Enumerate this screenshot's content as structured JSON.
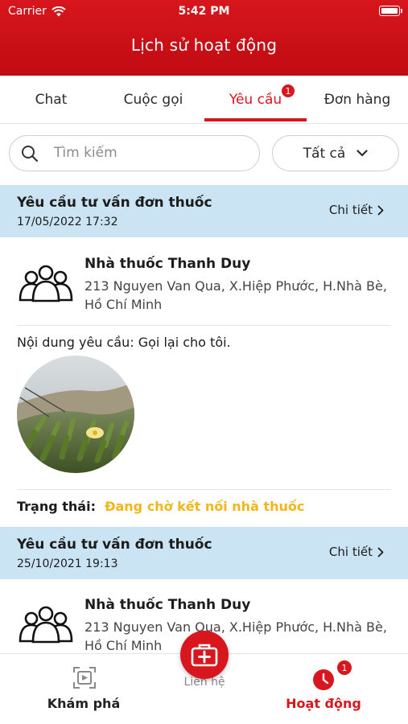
{
  "status_bar": {
    "carrier": "Carrier",
    "time": "5:42 PM"
  },
  "header": {
    "title": "Lịch sử hoạt động"
  },
  "tabs": [
    {
      "label": "Chat",
      "active": false
    },
    {
      "label": "Cuộc gọi",
      "active": false
    },
    {
      "label": "Yêu cầu",
      "active": true,
      "badge": "1"
    },
    {
      "label": "Đơn hàng",
      "active": false
    }
  ],
  "search": {
    "placeholder": "Tìm kiếm",
    "value": ""
  },
  "filter": {
    "selected": "Tất cả"
  },
  "requests": [
    {
      "title": "Yêu cầu tư vấn đơn thuốc",
      "date": "17/05/2022 17:32",
      "detail_label": "Chi tiết",
      "pharmacy_name": "Nhà thuốc Thanh Duy",
      "pharmacy_address": "213 Nguyen Van Qua, X.Hiệp Phước, H.Nhà Bè, Hồ Chí Minh",
      "content_label": "Nội dung yêu cầu:",
      "content": "Gọi lại cho tôi.",
      "status_label": "Trạng thái:",
      "status": "Đang chờ kết nối nhà thuốc"
    },
    {
      "title": "Yêu cầu tư vấn đơn thuốc",
      "date": "25/10/2021 19:13",
      "detail_label": "Chi tiết",
      "pharmacy_name": "Nhà thuốc Thanh Duy",
      "pharmacy_address": "213 Nguyen Van Qua, X.Hiệp Phước, H.Nhà Bè, Hồ Chí Minh"
    }
  ],
  "bottom_nav": {
    "explore": "Khám phá",
    "center_label": "Liên hệ",
    "activity": "Hoạt động",
    "activity_badge": "1"
  },
  "colors": {
    "brand_red": "#d7161d",
    "card_header_blue": "#cbe4f4",
    "status_yellow": "#f2b619"
  }
}
